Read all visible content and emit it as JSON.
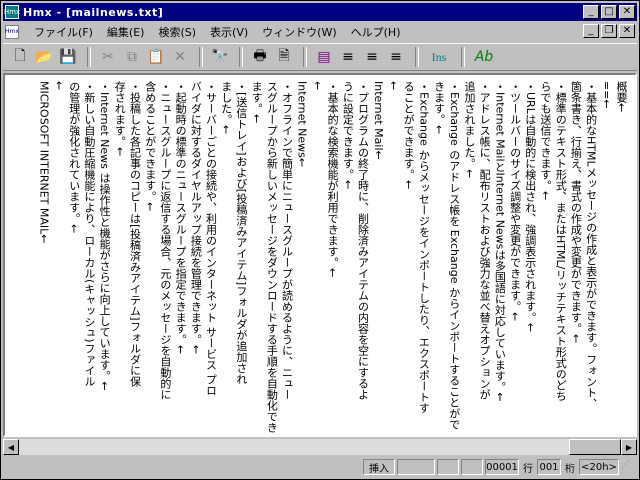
{
  "window": {
    "title": "Hmx - [mailnews.txt]"
  },
  "menu": [
    "ファイル(F)",
    "編集(E)",
    "検索(S)",
    "表示(V)",
    "ウィンドウ(W)",
    "ヘルプ(H)"
  ],
  "toolbar": {
    "ins_label": "Ins",
    "ab_label": "Ab"
  },
  "document": {
    "lines": [
      "概要←",
      "==←",
      "・基本的なHTMLメッセージの作成と表示ができます。フォント、",
      "箇条書き、行揃え、書式の作成や変更ができます。←",
      "・標準のテキスト形式、またはHTML/リッチテキスト形式のどち",
      "らでも送信できます。←",
      "・URLは自動的に検出され、強調表示されます。←",
      "・ツールバーのサイズ調整や変更ができます。←",
      "・Internet MailとInternet Newsは多国語に対応しています。←",
      "・アドレス帳に、配布リストおよび強力な並べ替えオプションが",
      "追加されました。←",
      "・Exchange のアドレス帳を Exchange からインポートすることができます。←",
      "・Exchange からメッセージをインポートしたり、エクスポートす",
      "ることができます。←",
      "←",
      "Internet Mail←",
      "・プログラムの終了時に、削除済みアイテムの内容を空にするよ",
      "うに設定できます。←",
      "・基本的な検索機能が利用できます。←",
      "←",
      "Internet News←",
      "・オフラインで簡単にニュースグループが読めるように、ニュー",
      "スグループから新しいメッセージをダウンロードする手順を自動化できます。←",
      "・[送信トレイ]および[投稿済みアイテム]フォルダが追加され",
      "ました。←",
      "・サーバーごとの接続や、利用のインターネット サービス プロ",
      "バイダに対するダイヤルアップ接続を管理できます。←",
      "・起動時の標準のニュースグループを指定できます。←",
      "・ニュースグループに返信する場合、元のメッセージを自動的に",
      "含めることができます。←",
      "・投稿した各記事のコピーは[投稿済みアイテム]フォルダに保",
      "存されます。←",
      "・Internet News は操作性と機能がさらに向上しています。←",
      "・新しい自動圧縮機能により、ローカル(キャッシュ)ファイル",
      "の管理が強化されています。←",
      "←",
      "MICROSOFT INTERNET MAIL←"
    ]
  },
  "status": {
    "mode": "挿入",
    "page": "00001",
    "row_label": "行",
    "row": "001",
    "col_label": "桁",
    "col": "<20h>"
  }
}
